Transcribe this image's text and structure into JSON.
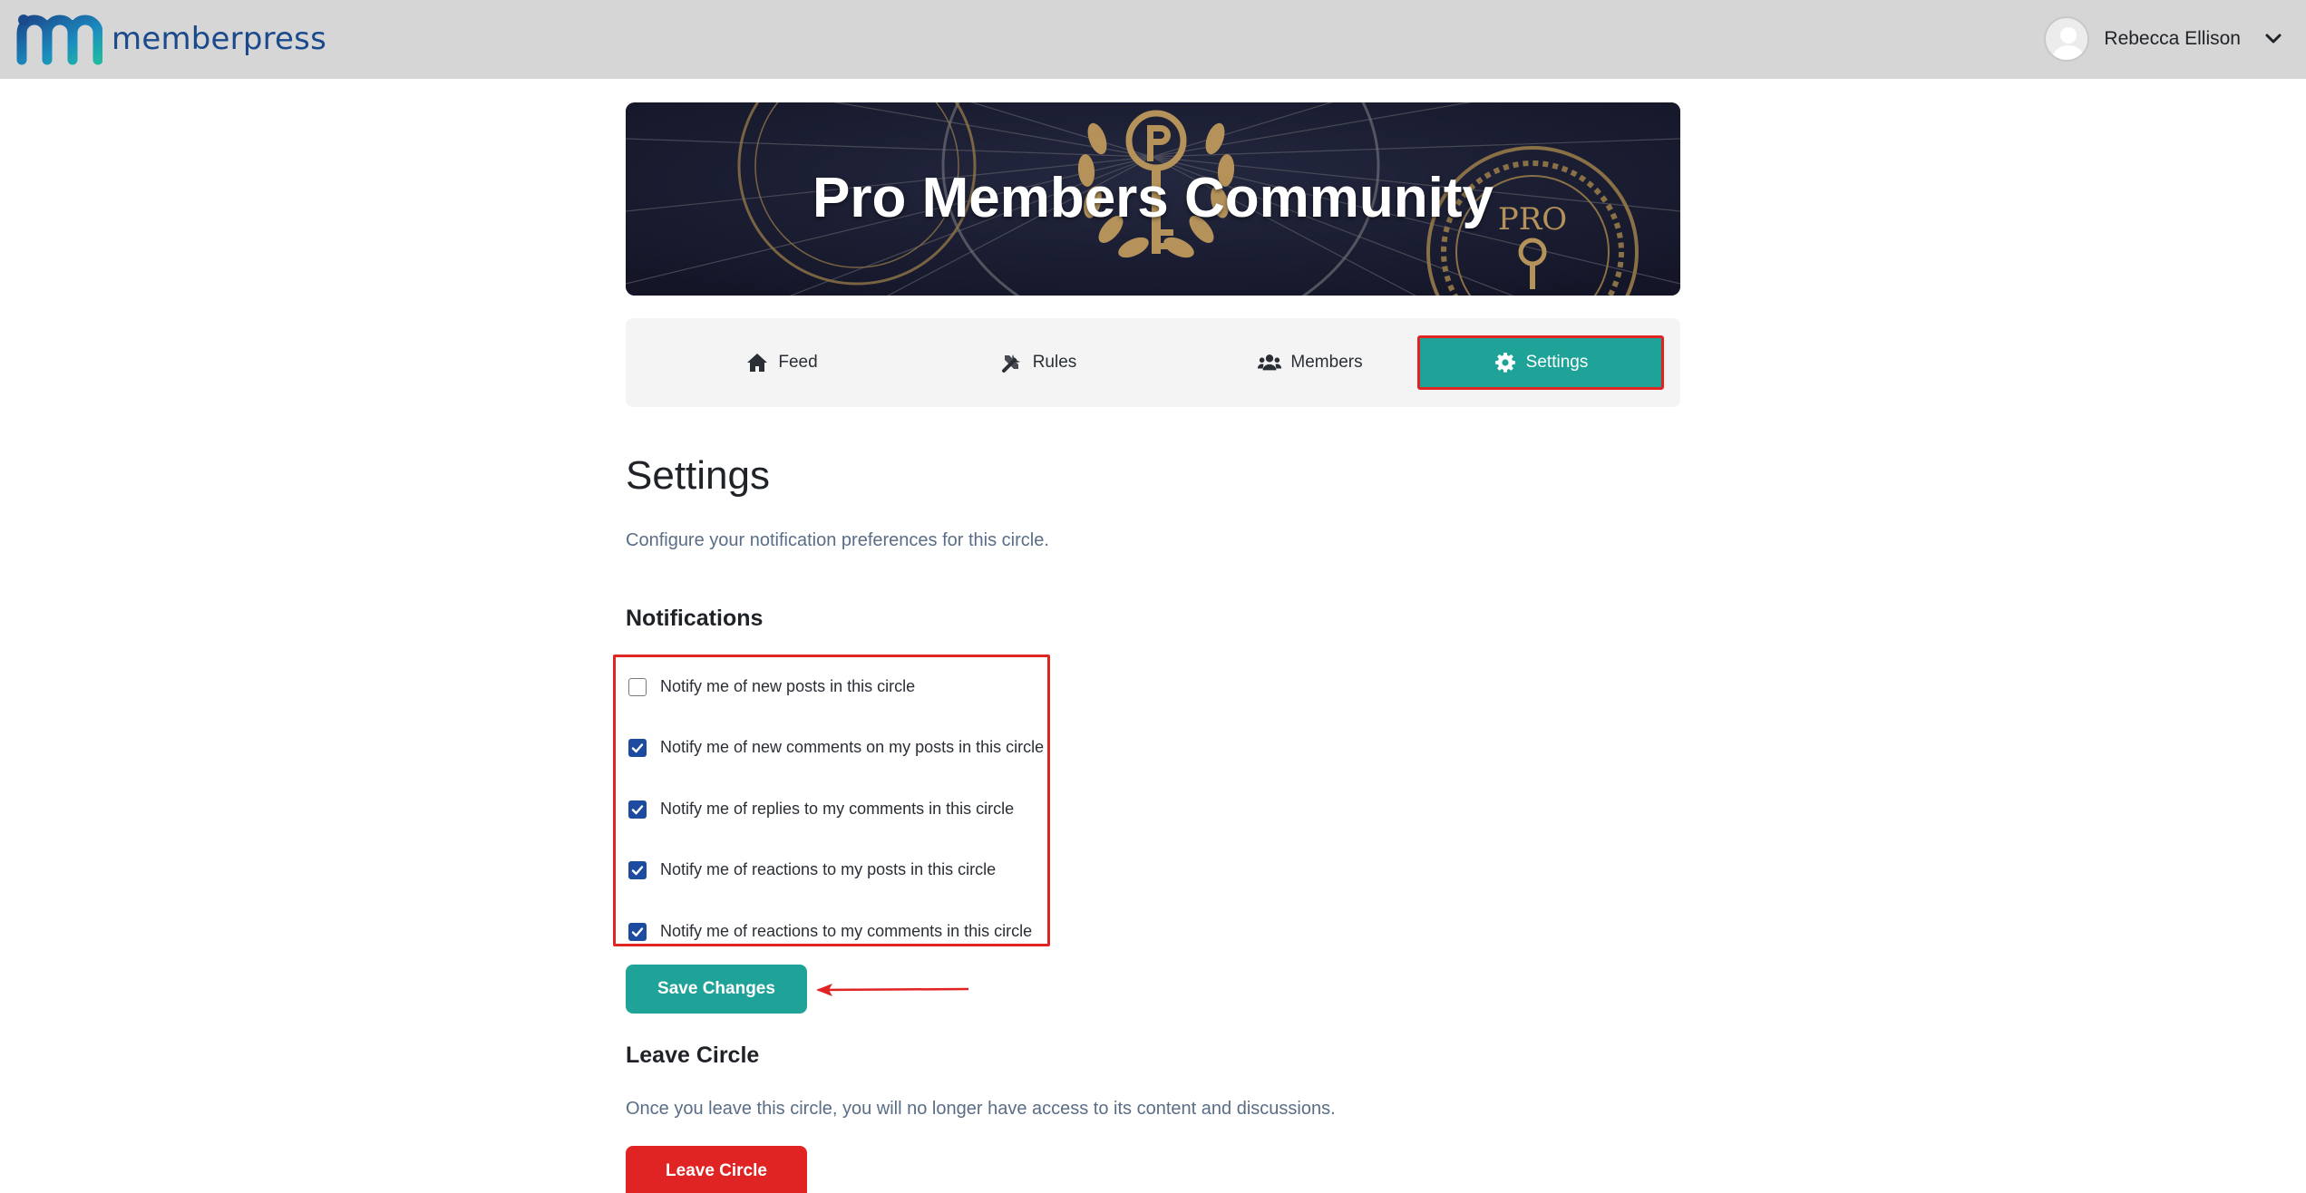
{
  "brand": {
    "name": "memberpress",
    "colors": {
      "teal": "#1fa399",
      "blue": "#1b4a8c",
      "red": "#e02424"
    }
  },
  "user": {
    "name": "Rebecca Ellison",
    "menu_icon": "chevron-down-icon"
  },
  "banner": {
    "title": "Pro Members Community",
    "emblem_text": "PRO"
  },
  "tabs": [
    {
      "label": "Feed",
      "icon": "home-icon",
      "active": false
    },
    {
      "label": "Rules",
      "icon": "tools-icon",
      "active": false
    },
    {
      "label": "Members",
      "icon": "users-icon",
      "active": false
    },
    {
      "label": "Settings",
      "icon": "gear-icon",
      "active": true
    }
  ],
  "settings": {
    "title": "Settings",
    "subtitle": "Configure your notification preferences for this circle.",
    "notifications_heading": "Notifications",
    "options": [
      {
        "label": "Notify me of new posts in this circle",
        "checked": false
      },
      {
        "label": "Notify me of new comments on my posts in this circle",
        "checked": true
      },
      {
        "label": "Notify me of replies to my comments in this circle",
        "checked": true
      },
      {
        "label": "Notify me of reactions to my posts in this circle",
        "checked": true
      },
      {
        "label": "Notify me of reactions to my comments in this circle",
        "checked": true
      }
    ],
    "save_label": "Save Changes"
  },
  "leave": {
    "heading": "Leave Circle",
    "text": "Once you leave this circle, you will no longer have access to its content and discussions.",
    "button_label": "Leave Circle"
  }
}
